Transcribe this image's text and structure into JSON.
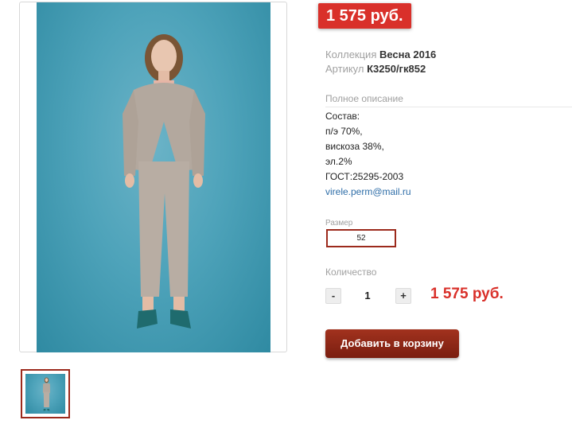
{
  "product": {
    "price_badge": "1 575 руб.",
    "collection_label": "Коллекция",
    "collection_value": "Весна 2016",
    "article_label": "Артикул",
    "article_value": "К3250/гк852"
  },
  "description": {
    "title": "Полное описание",
    "lines": [
      "Состав:",
      "п/э 70%,",
      "вискоза 38%,",
      "эл.2%",
      "ГОСТ:25295-2003"
    ],
    "email": "virele.perm@mail.ru"
  },
  "size": {
    "label": "Размер",
    "selected": "52"
  },
  "quantity": {
    "label": "Количество",
    "minus": "-",
    "value": "1",
    "plus": "+",
    "total": "1 575 руб."
  },
  "actions": {
    "add_to_cart": "Добавить в корзину"
  },
  "colors": {
    "accent_red": "#d9302a",
    "button_dark_red": "#8b2415",
    "photo_background": "#4ea3ba",
    "link": "#2f6ea8"
  }
}
